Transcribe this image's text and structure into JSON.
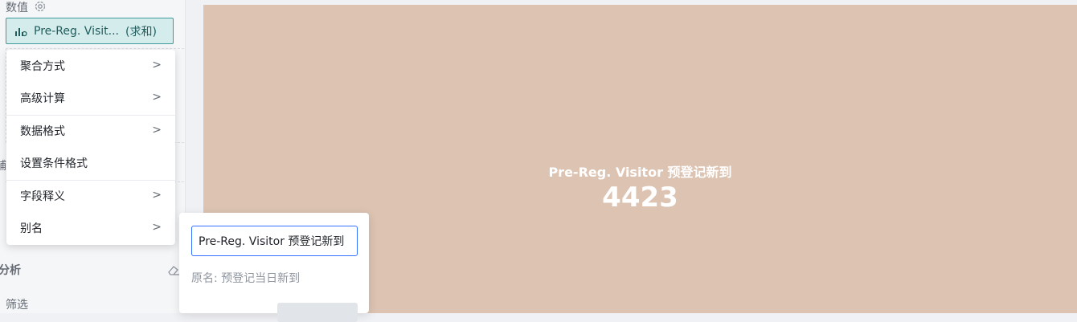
{
  "left_panel": {
    "values_label": "数值",
    "field_pill": {
      "name": "Pre-Reg. Visit...",
      "aggregation": "(求和)"
    },
    "analysis_label": "分析",
    "filter_label": "筛选"
  },
  "context_menu": {
    "items": [
      {
        "label": "聚合方式",
        "has_submenu": true
      },
      {
        "label": "高级计算",
        "has_submenu": true
      },
      {
        "label": "数据格式",
        "has_submenu": true
      },
      {
        "label": "设置条件格式",
        "has_submenu": false
      },
      {
        "label": "字段释义",
        "has_submenu": true
      },
      {
        "label": "别名",
        "has_submenu": true
      }
    ]
  },
  "canvas": {
    "kpi_title": "Pre-Reg. Visitor 预登记新到",
    "kpi_value": "4423",
    "background_color": "#dcc3b2"
  },
  "alias_popover": {
    "input_value": "Pre-Reg. Visitor 预登记新到",
    "original_name": "原名: 预登记当日新到"
  }
}
